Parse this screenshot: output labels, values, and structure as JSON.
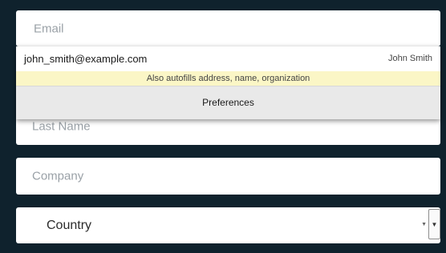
{
  "form": {
    "email_placeholder": "Email",
    "last_name_placeholder": "Last Name",
    "company_placeholder": "Company",
    "country_selected": "Country"
  },
  "autofill": {
    "suggestion_email": "john_smith@example.com",
    "suggestion_name": "John Smith",
    "hint": "Also autofills address, name, organization",
    "preferences_label": "Preferences"
  },
  "icons": {
    "select_arrow": "chevron-down-icon"
  },
  "colors": {
    "background": "#0f222d",
    "hint_background": "#fbf6c6",
    "preferences_background": "#e9e9e9"
  }
}
